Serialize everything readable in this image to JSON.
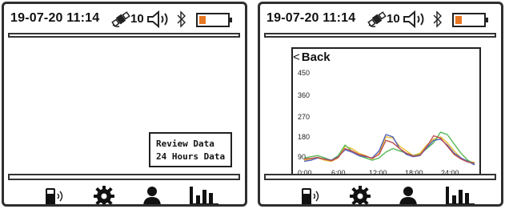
{
  "status": {
    "datetime": "19-07-20  11:14",
    "satellite_count": "10",
    "icons": [
      "satellite-icon",
      "speaker-icon",
      "bluetooth-icon",
      "battery-icon"
    ],
    "battery_color": "#e87722"
  },
  "nav": {
    "items": [
      "device-icon",
      "settings-gear-icon",
      "user-icon",
      "chart-bars-icon"
    ]
  },
  "left": {
    "menu": [
      "Review Data",
      "24 Hours Data"
    ]
  },
  "right": {
    "back_label": "Back",
    "chart_data": {
      "type": "line",
      "title": "",
      "xlabel": "",
      "ylabel": "",
      "x_ticks": [
        "0:00",
        "6:00",
        "12:00",
        "18:00",
        "24:00"
      ],
      "y_ticks": [
        "450",
        "360",
        "270",
        "180",
        "90"
      ],
      "ylim": [
        0,
        450
      ],
      "xlim": [
        0,
        24
      ],
      "grid": false,
      "x": [
        0,
        1,
        2,
        3,
        4,
        5,
        6,
        7,
        8,
        9,
        10,
        11,
        12,
        13,
        14,
        15,
        16,
        17,
        18,
        19,
        20,
        21,
        22,
        23,
        24,
        25
      ],
      "series": [
        {
          "color": "#e8c030",
          "values": [
            100,
            105,
            110,
            100,
            95,
            110,
            160,
            150,
            130,
            120,
            105,
            130,
            200,
            195,
            160,
            140,
            120,
            130,
            165,
            190,
            200,
            175,
            140,
            110,
            95,
            90
          ]
        },
        {
          "color": "#58b858",
          "values": [
            110,
            115,
            120,
            110,
            100,
            120,
            165,
            140,
            120,
            110,
            100,
            110,
            135,
            150,
            140,
            130,
            120,
            125,
            150,
            175,
            220,
            210,
            170,
            130,
            100,
            85
          ]
        },
        {
          "color": "#5060c0",
          "values": [
            95,
            100,
            110,
            105,
            100,
            115,
            145,
            135,
            120,
            115,
            110,
            140,
            210,
            200,
            150,
            125,
            115,
            120,
            155,
            185,
            190,
            165,
            130,
            110,
            95,
            80
          ]
        },
        {
          "color": "#c05050",
          "values": [
            105,
            108,
            112,
            104,
            98,
            112,
            150,
            140,
            125,
            118,
            108,
            125,
            185,
            175,
            150,
            130,
            118,
            122,
            160,
            205,
            195,
            160,
            125,
            105,
            92,
            88
          ]
        }
      ]
    }
  }
}
